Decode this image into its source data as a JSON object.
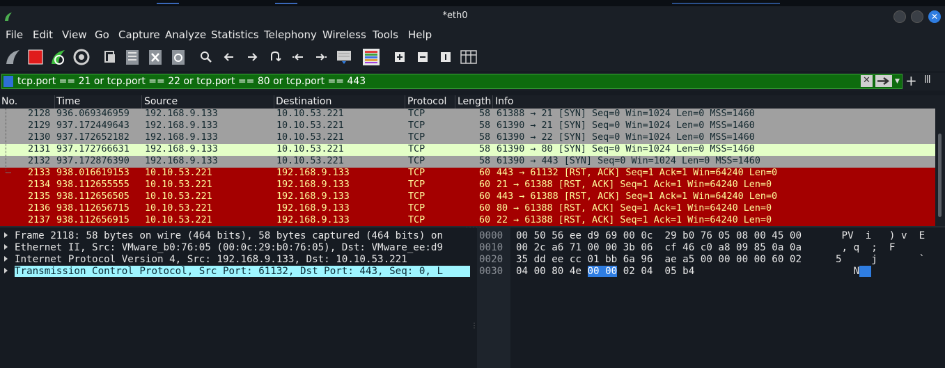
{
  "window": {
    "title": "*eth0",
    "close_glyph": "✕"
  },
  "menu": [
    "File",
    "Edit",
    "View",
    "Go",
    "Capture",
    "Analyze",
    "Statistics",
    "Telephony",
    "Wireless",
    "Tools",
    "Help"
  ],
  "toolbar_icons": [
    "start-capture-icon",
    "stop-capture-icon",
    "restart-capture-icon",
    "capture-options-icon",
    "open-file-icon",
    "save-file-icon",
    "close-file-icon",
    "reload-file-icon",
    "find-packet-icon",
    "go-back-icon",
    "go-forward-icon",
    "go-to-packet-icon",
    "first-packet-icon",
    "last-packet-icon",
    "auto-scroll-icon",
    "colorize-icon",
    "zoom-in-icon",
    "zoom-out-icon",
    "normal-size-icon",
    "resize-columns-icon"
  ],
  "filter": {
    "text": "tcp.port == 21 or tcp.port == 22 or tcp.port == 80 or tcp.port == 443",
    "clear_glyph": "✕",
    "plus_glyph": "+",
    "cols_glyph": "lll"
  },
  "columns": [
    "No.",
    "Time",
    "Source",
    "Destination",
    "Protocol",
    "Length",
    "Info"
  ],
  "packets": [
    {
      "no": "2128",
      "time": "936.069346959",
      "src": "192.168.9.133",
      "dst": "10.10.53.221",
      "proto": "TCP",
      "len": "58",
      "info": "61388 → 21 [SYN] Seq=0 Win=1024 Len=0 MSS=1460",
      "style": "syn"
    },
    {
      "no": "2129",
      "time": "937.172449643",
      "src": "192.168.9.133",
      "dst": "10.10.53.221",
      "proto": "TCP",
      "len": "58",
      "info": "61390 → 21 [SYN] Seq=0 Win=1024 Len=0 MSS=1460",
      "style": "syn"
    },
    {
      "no": "2130",
      "time": "937.172652182",
      "src": "192.168.9.133",
      "dst": "10.10.53.221",
      "proto": "TCP",
      "len": "58",
      "info": "61390 → 22 [SYN] Seq=0 Win=1024 Len=0 MSS=1460",
      "style": "syn"
    },
    {
      "no": "2131",
      "time": "937.172766631",
      "src": "192.168.9.133",
      "dst": "10.10.53.221",
      "proto": "TCP",
      "len": "58",
      "info": "61390 → 80 [SYN] Seq=0 Win=1024 Len=0 MSS=1460",
      "style": "sel"
    },
    {
      "no": "2132",
      "time": "937.172876390",
      "src": "192.168.9.133",
      "dst": "10.10.53.221",
      "proto": "TCP",
      "len": "58",
      "info": "61390 → 443 [SYN] Seq=0 Win=1024 Len=0 MSS=1460",
      "style": "syn"
    },
    {
      "no": "2133",
      "time": "938.016619153",
      "src": "10.10.53.221",
      "dst": "192.168.9.133",
      "proto": "TCP",
      "len": "60",
      "info": "443 → 61132 [RST, ACK] Seq=1 Ack=1 Win=64240 Len=0",
      "style": "rst"
    },
    {
      "no": "2134",
      "time": "938.112655555",
      "src": "10.10.53.221",
      "dst": "192.168.9.133",
      "proto": "TCP",
      "len": "60",
      "info": "21 → 61388 [RST, ACK] Seq=1 Ack=1 Win=64240 Len=0",
      "style": "rst"
    },
    {
      "no": "2135",
      "time": "938.112656505",
      "src": "10.10.53.221",
      "dst": "192.168.9.133",
      "proto": "TCP",
      "len": "60",
      "info": "443 → 61388 [RST, ACK] Seq=1 Ack=1 Win=64240 Len=0",
      "style": "rst"
    },
    {
      "no": "2136",
      "time": "938.112656715",
      "src": "10.10.53.221",
      "dst": "192.168.9.133",
      "proto": "TCP",
      "len": "60",
      "info": "80 → 61388 [RST, ACK] Seq=1 Ack=1 Win=64240 Len=0",
      "style": "rst"
    },
    {
      "no": "2137",
      "time": "938.112656915",
      "src": "10.10.53.221",
      "dst": "192.168.9.133",
      "proto": "TCP",
      "len": "60",
      "info": "22 → 61388 [RST, ACK] Seq=1 Ack=1 Win=64240 Len=0",
      "style": "rst"
    }
  ],
  "details": [
    "Frame 2118: 58 bytes on wire (464 bits), 58 bytes captured (464 bits) on",
    "Ethernet II, Src: VMware_b0:76:05 (00:0c:29:b0:76:05), Dst: VMware_ee:d9",
    "Internet Protocol Version 4, Src: 192.168.9.133, Dst: 10.10.53.221",
    "Transmission Control Protocol, Src Port: 61132, Dst Port: 443, Seq: 0, L"
  ],
  "bytes": [
    {
      "off": "0000",
      "hex_pre": "00 50 56 ee d9 69 00 0c  29 b0 76 05 08 00 45 00",
      "hex_hl": "",
      "hex_post": "",
      "asc_pre": " PV  i   ) v  E",
      "asc_hl": "",
      "asc_post": ""
    },
    {
      "off": "0010",
      "hex_pre": "00 2c a6 71 00 00 3b 06  cf 46 c0 a8 09 85 0a 0a",
      "hex_hl": "",
      "hex_post": "",
      "asc_pre": " , q  ;  F",
      "asc_hl": "",
      "asc_post": ""
    },
    {
      "off": "0020",
      "hex_pre": "35 dd ee cc 01 bb 6a 96  ae a5 00 00 00 00 60 02",
      "hex_hl": "",
      "hex_post": "",
      "asc_pre": "5     j       `",
      "asc_hl": "",
      "asc_post": ""
    },
    {
      "off": "0030",
      "hex_pre": "04 00 80 4e ",
      "hex_hl": "00 00",
      "hex_post": " 02 04  05 b4",
      "asc_pre": "   N",
      "asc_hl": "  ",
      "asc_post": ""
    }
  ]
}
